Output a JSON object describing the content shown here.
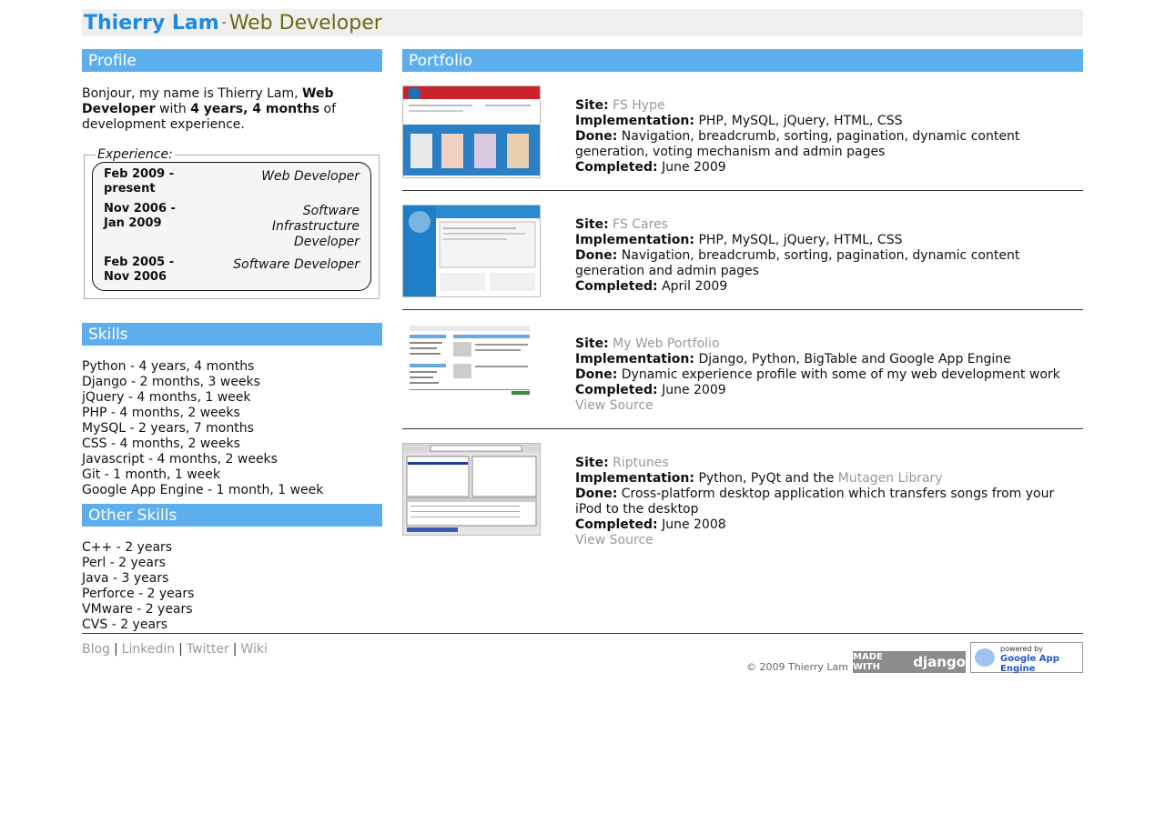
{
  "header": {
    "name": "Thierry Lam",
    "separator": "-",
    "role": "Web Developer"
  },
  "profile": {
    "heading": "Profile",
    "intro_1": "Bonjour, my name is Thierry Lam, ",
    "intro_bold_1": "Web Developer",
    "intro_2": " with ",
    "intro_bold_2": "4 years, 4 months",
    "intro_3": " of development experience.",
    "experience_legend": "Experience:",
    "experience": [
      {
        "date": "Feb 2009 - present",
        "title": "Web Developer"
      },
      {
        "date": "Nov 2006 - Jan 2009",
        "title": "Software Infrastructure Developer"
      },
      {
        "date": "Feb 2005 - Nov 2006",
        "title": "Software Developer"
      }
    ]
  },
  "skills": {
    "heading": "Skills",
    "items": [
      "Python - 4 years, 4 months",
      "Django - 2 months, 3 weeks",
      "jQuery - 4 months, 1 week",
      "PHP - 4 months, 2 weeks",
      "MySQL - 2 years, 7 months",
      "CSS - 4 months, 2 weeks",
      "Javascript - 4 months, 2 weeks",
      "Git - 1 month, 1 week",
      "Google App Engine - 1 month, 1 week"
    ]
  },
  "other_skills": {
    "heading": "Other Skills",
    "items": [
      "C++ - 2 years",
      "Perl - 2 years",
      "Java - 3 years",
      "Perforce - 2 years",
      "VMware - 2 years",
      "CVS - 2 years"
    ]
  },
  "portfolio": {
    "heading": "Portfolio",
    "labels": {
      "site": "Site:",
      "implementation": "Implementation:",
      "done": "Done:",
      "completed": "Completed:"
    },
    "items": [
      {
        "site": "FS Hype",
        "implementation": "PHP, MySQL, jQuery, HTML, CSS",
        "done": "Navigation, breadcrumb, sorting, pagination, dynamic content generation, voting mechanism and admin pages",
        "completed": "June 2009",
        "source": ""
      },
      {
        "site": "FS Cares",
        "implementation": "PHP, MySQL, jQuery, HTML, CSS",
        "done": "Navigation, breadcrumb, sorting, pagination, dynamic content generation and admin pages",
        "completed": "April 2009",
        "source": ""
      },
      {
        "site": "My Web Portfolio",
        "implementation": "Django, Python, BigTable and Google App Engine",
        "done": "Dynamic experience profile with some of my web development work",
        "completed": "June 2009",
        "source": "View Source"
      },
      {
        "site": "Riptunes",
        "implementation_prefix": "Python, PyQt and the ",
        "implementation_link": "Mutagen Library",
        "done": "Cross-platform desktop application which transfers songs from your iPod to the desktop",
        "completed": "June 2008",
        "source": "View Source"
      }
    ]
  },
  "footer": {
    "links": [
      "Blog",
      "Linkedin",
      "Twitter",
      "Wiki"
    ],
    "link_separator": "|",
    "copyright": "© 2009 Thierry Lam",
    "badge_django_1": "MADE WITH",
    "badge_django_2": "django",
    "badge_gae_1": "powered by",
    "badge_gae_2": "Google App Engine"
  },
  "colors": {
    "accent_bar": "#5daeed",
    "name": "#1e8ae0",
    "role": "#6b6b12",
    "link_grey": "#999999"
  }
}
